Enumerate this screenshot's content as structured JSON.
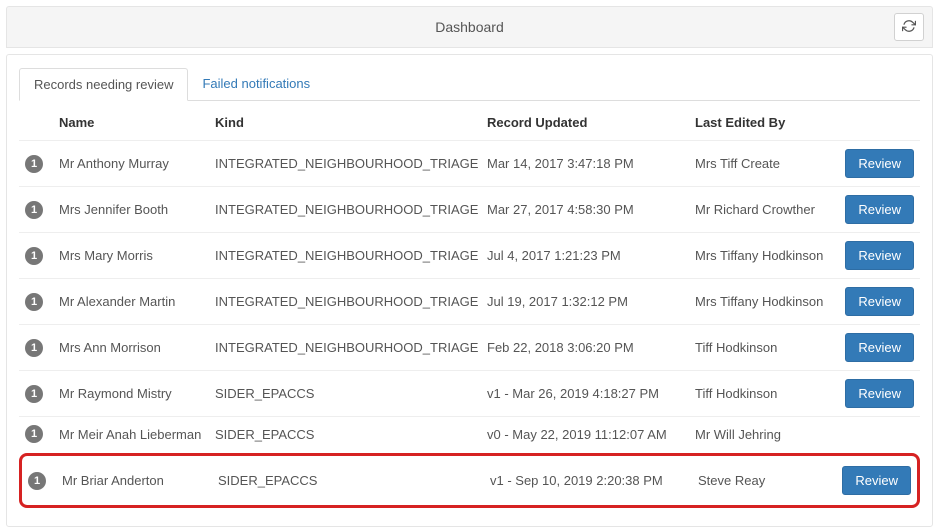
{
  "header": {
    "title": "Dashboard"
  },
  "tabs": {
    "records": "Records needing review",
    "failed": "Failed notifications"
  },
  "columns": {
    "name": "Name",
    "kind": "Kind",
    "updated": "Record Updated",
    "editor": "Last Edited By"
  },
  "review_label": "Review",
  "rows": [
    {
      "count": "1",
      "name": "Mr Anthony Murray",
      "kind": "INTEGRATED_NEIGHBOURHOOD_TRIAGE",
      "updated": "Mar 14, 2017 3:47:18 PM",
      "editor": "Mrs Tiff Create",
      "has_button": true,
      "highlight": false
    },
    {
      "count": "1",
      "name": "Mrs Jennifer Booth",
      "kind": "INTEGRATED_NEIGHBOURHOOD_TRIAGE",
      "updated": "Mar 27, 2017 4:58:30 PM",
      "editor": "Mr Richard Crowther",
      "has_button": true,
      "highlight": false
    },
    {
      "count": "1",
      "name": "Mrs Mary Morris",
      "kind": "INTEGRATED_NEIGHBOURHOOD_TRIAGE",
      "updated": "Jul 4, 2017 1:21:23 PM",
      "editor": "Mrs Tiffany Hodkinson",
      "has_button": true,
      "highlight": false
    },
    {
      "count": "1",
      "name": "Mr Alexander Martin",
      "kind": "INTEGRATED_NEIGHBOURHOOD_TRIAGE",
      "updated": "Jul 19, 2017 1:32:12 PM",
      "editor": "Mrs Tiffany Hodkinson",
      "has_button": true,
      "highlight": false
    },
    {
      "count": "1",
      "name": "Mrs Ann Morrison",
      "kind": "INTEGRATED_NEIGHBOURHOOD_TRIAGE",
      "updated": "Feb 22, 2018 3:06:20 PM",
      "editor": "Tiff Hodkinson",
      "has_button": true,
      "highlight": false
    },
    {
      "count": "1",
      "name": "Mr Raymond Mistry",
      "kind": "SIDER_EPACCS",
      "updated": "v1 - Mar 26, 2019 4:18:27 PM",
      "editor": "Tiff Hodkinson",
      "has_button": true,
      "highlight": false
    },
    {
      "count": "1",
      "name": "Mr Meir Anah Lieberman",
      "kind": "SIDER_EPACCS",
      "updated": "v0 - May 22, 2019 11:12:07 AM",
      "editor": "Mr Will Jehring",
      "has_button": false,
      "highlight": false
    },
    {
      "count": "1",
      "name": "Mr Briar Anderton",
      "kind": "SIDER_EPACCS",
      "updated": "v1 - Sep 10, 2019 2:20:38 PM",
      "editor": "Steve Reay",
      "has_button": true,
      "highlight": true
    }
  ]
}
